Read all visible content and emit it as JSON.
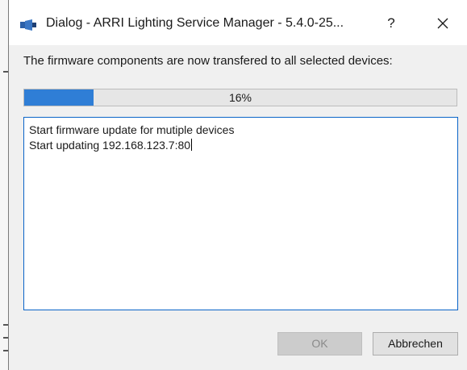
{
  "window": {
    "title": "Dialog - ARRI Lighting Service Manager - 5.4.0-25...",
    "help_label": "?",
    "close_label": "×",
    "app_icon": "arri-app-icon"
  },
  "dialog": {
    "message": "The firmware components are now transfered to all selected devices:",
    "progress": {
      "percent": 16,
      "label": "16%"
    },
    "log_lines": [
      "Start firmware update for mutiple devices",
      "Start updating 192.168.123.7:80"
    ]
  },
  "buttons": {
    "ok_label": "OK",
    "ok_enabled": false,
    "cancel_label": "Abbrechen"
  },
  "colors": {
    "progress_fill": "#2f7ed6",
    "log_border": "#0a64c8"
  }
}
